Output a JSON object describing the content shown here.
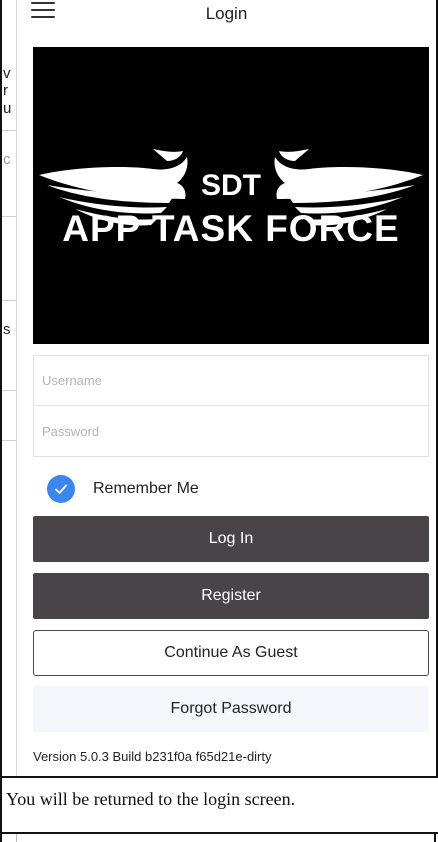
{
  "header": {
    "title": "Login",
    "menu_icon": "hamburger-menu-icon"
  },
  "banner": {
    "brand": "SDT",
    "headline": "APP TASK FORCE",
    "background_color": "#000000"
  },
  "form": {
    "username_placeholder": "Username",
    "password_placeholder": "Password",
    "username_value": "",
    "password_value": "",
    "remember_me_label": "Remember Me",
    "remember_me_checked": true
  },
  "buttons": {
    "login_label": "Log In",
    "register_label": "Register",
    "guest_label": "Continue As Guest",
    "forgot_label": "Forgot Password"
  },
  "version_text": "Version 5.0.3 Build b231f0a f65d21e-dirty",
  "caption": "You will be returned to the login screen.",
  "left_rail_fragments": [
    "v",
    "r",
    "u",
    "c",
    "s"
  ],
  "colors": {
    "accent": "#3b86ef",
    "button_dark": "#494447",
    "forgot_bg": "#f5f6fb"
  }
}
